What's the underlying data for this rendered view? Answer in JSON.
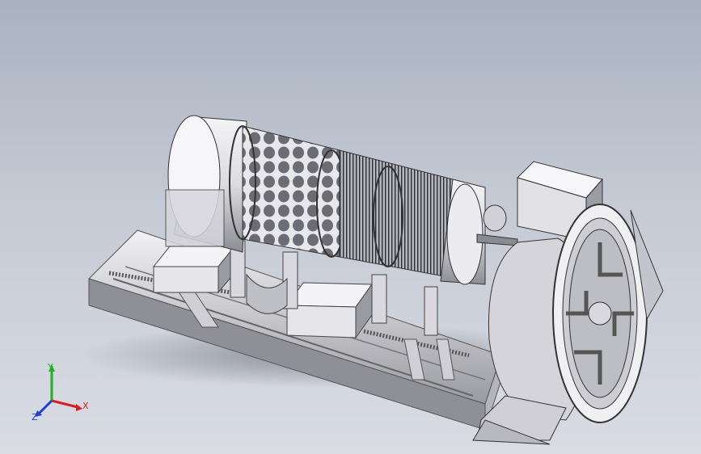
{
  "viewport": {
    "background_top": "#aab2c0",
    "background_bottom": "#d9dce3"
  },
  "model": {
    "icon": "trommel-screen-assembly"
  },
  "triad": {
    "x_label": "X",
    "y_label": "Y",
    "z_label": "Z",
    "x_color": "#d42020",
    "y_color": "#20b020",
    "z_color": "#2040d0"
  }
}
